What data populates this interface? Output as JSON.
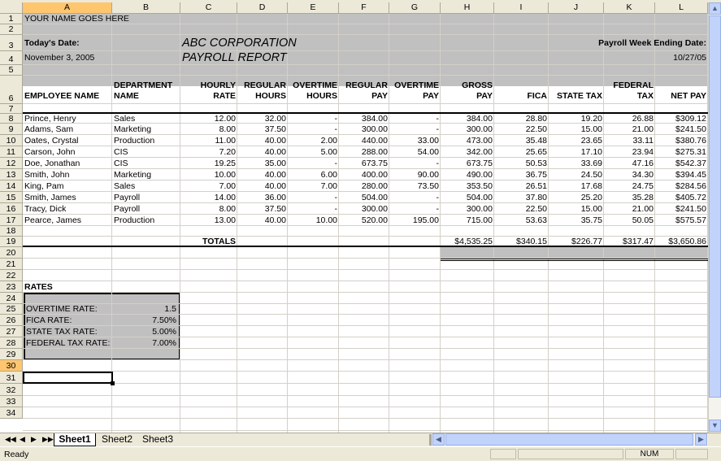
{
  "columns": [
    "A",
    "B",
    "C",
    "D",
    "E",
    "F",
    "G",
    "H",
    "I",
    "J",
    "K",
    "L"
  ],
  "rows": [
    "1",
    "2",
    "3",
    "4",
    "5",
    "6",
    "7",
    "8",
    "9",
    "10",
    "11",
    "12",
    "13",
    "14",
    "15",
    "16",
    "17",
    "18",
    "19",
    "20",
    "21",
    "22",
    "23",
    "24",
    "25",
    "26",
    "27",
    "28",
    "29",
    "30",
    "31",
    "32",
    "33",
    "34"
  ],
  "header": {
    "your_name": "YOUR NAME GOES HERE",
    "todays_date_label": "Today's Date:",
    "todays_date": "November 3, 2005",
    "company": "ABC CORPORATION",
    "report": "PAYROLL REPORT",
    "week_ending_label": "Payroll Week Ending Date:",
    "week_ending": "10/27/05"
  },
  "col_headers": [
    [
      "",
      "EMPLOYEE NAME"
    ],
    [
      "DEPARTMENT",
      "NAME"
    ],
    [
      "HOURLY",
      "RATE"
    ],
    [
      "REGULAR",
      "HOURS"
    ],
    [
      "OVERTIME",
      "HOURS"
    ],
    [
      "REGULAR",
      "PAY"
    ],
    [
      "OVERTIME",
      "PAY"
    ],
    [
      "GROSS",
      "PAY"
    ],
    [
      "",
      "FICA"
    ],
    [
      "",
      "STATE TAX"
    ],
    [
      "FEDERAL",
      "TAX"
    ],
    [
      "",
      "NET PAY"
    ]
  ],
  "employees": [
    [
      "Prince, Henry",
      "Sales",
      "12.00",
      "32.00",
      "-",
      "384.00",
      "-",
      "384.00",
      "28.80",
      "19.20",
      "26.88",
      "$309.12"
    ],
    [
      "Adams, Sam",
      "Marketing",
      "8.00",
      "37.50",
      "-",
      "300.00",
      "-",
      "300.00",
      "22.50",
      "15.00",
      "21.00",
      "$241.50"
    ],
    [
      "Oates, Crystal",
      "Production",
      "11.00",
      "40.00",
      "2.00",
      "440.00",
      "33.00",
      "473.00",
      "35.48",
      "23.65",
      "33.11",
      "$380.76"
    ],
    [
      "Carson, John",
      "CIS",
      "7.20",
      "40.00",
      "5.00",
      "288.00",
      "54.00",
      "342.00",
      "25.65",
      "17.10",
      "23.94",
      "$275.31"
    ],
    [
      "Doe, Jonathan",
      "CIS",
      "19.25",
      "35.00",
      "-",
      "673.75",
      "-",
      "673.75",
      "50.53",
      "33.69",
      "47.16",
      "$542.37"
    ],
    [
      "Smith, John",
      "Marketing",
      "10.00",
      "40.00",
      "6.00",
      "400.00",
      "90.00",
      "490.00",
      "36.75",
      "24.50",
      "34.30",
      "$394.45"
    ],
    [
      "King, Pam",
      "Sales",
      "7.00",
      "40.00",
      "7.00",
      "280.00",
      "73.50",
      "353.50",
      "26.51",
      "17.68",
      "24.75",
      "$284.56"
    ],
    [
      "Smith, James",
      "Payroll",
      "14.00",
      "36.00",
      "-",
      "504.00",
      "-",
      "504.00",
      "37.80",
      "25.20",
      "35.28",
      "$405.72"
    ],
    [
      "Tracy, Dick",
      "Payroll",
      "8.00",
      "37.50",
      "-",
      "300.00",
      "-",
      "300.00",
      "22.50",
      "15.00",
      "21.00",
      "$241.50"
    ],
    [
      "Pearce, James",
      "Production",
      "13.00",
      "40.00",
      "10.00",
      "520.00",
      "195.00",
      "715.00",
      "53.63",
      "35.75",
      "50.05",
      "$575.57"
    ]
  ],
  "totals": {
    "label": "TOTALS",
    "gross": "$4,535.25",
    "fica": "$340.15",
    "state": "$226.77",
    "federal": "$317.47",
    "net": "$3,650.86"
  },
  "rates": {
    "title": "RATES",
    "items": [
      [
        "OVERTIME RATE:",
        "1.5"
      ],
      [
        "FICA RATE:",
        "7.50%"
      ],
      [
        "STATE TAX RATE:",
        "5.00%"
      ],
      [
        "FEDERAL TAX RATE:",
        "7.00%"
      ]
    ]
  },
  "sheet_tabs": [
    "Sheet1",
    "Sheet2",
    "Sheet3"
  ],
  "status": {
    "left": "Ready",
    "num": "NUM"
  },
  "colors": {
    "header_fill": "#c0c0c0",
    "grid": "#d4d0c8",
    "chrome": "#ece9d8",
    "selected_header": "#ffc66e"
  }
}
